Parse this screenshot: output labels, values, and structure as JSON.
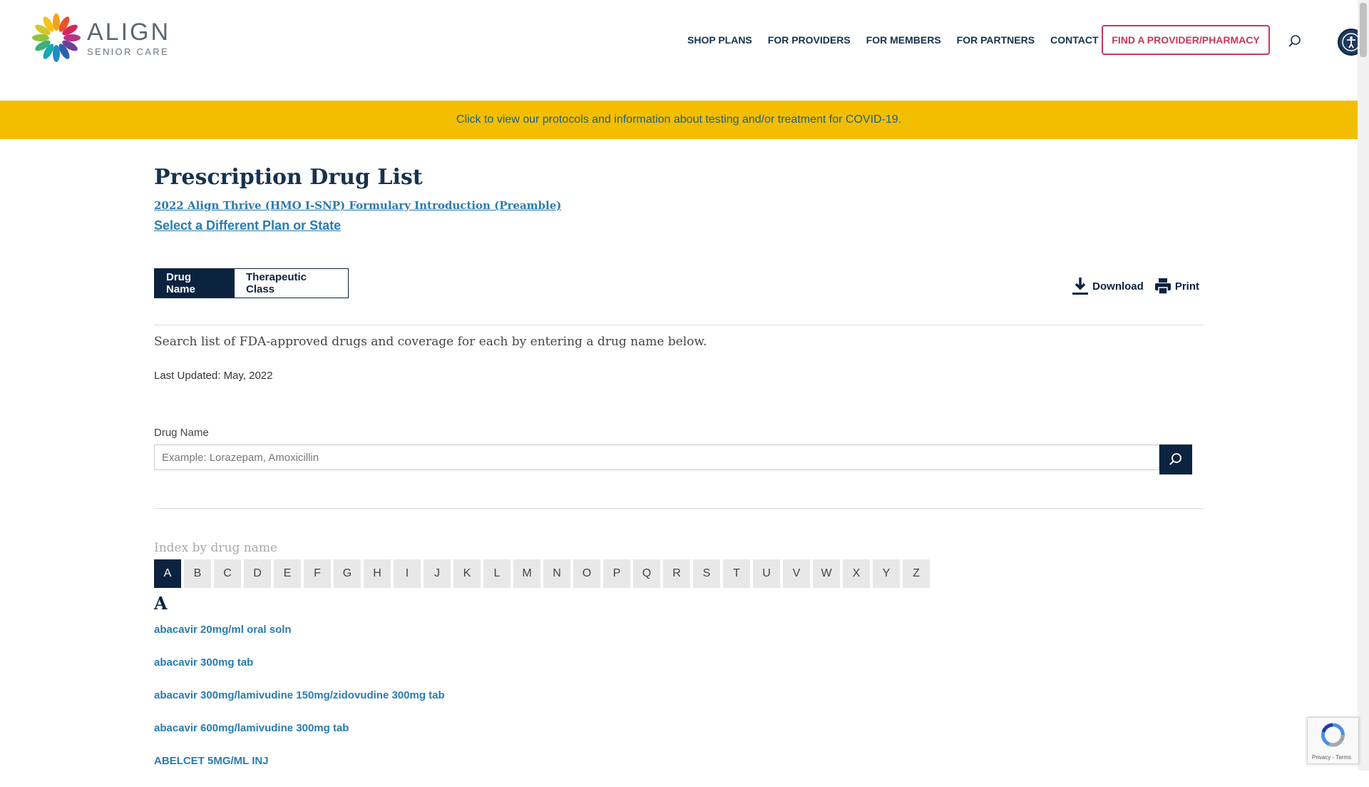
{
  "header": {
    "logo_main": "ALIGN",
    "logo_sub": "SENIOR CARE",
    "nav": [
      "SHOP PLANS",
      "FOR PROVIDERS",
      "FOR MEMBERS",
      "FOR PARTNERS",
      "CONTACT US"
    ],
    "find_button": "FIND A PROVIDER/PHARMACY"
  },
  "banner": {
    "text": "Click to view our protocols and information about testing and/or treatment for COVID-19."
  },
  "main": {
    "title": "Prescription Drug List",
    "preamble_link": "2022 Align Thrive (HMO I-SNP) Formulary Introduction (Preamble)",
    "plan_link": "Select a Different Plan or State",
    "tabs": [
      {
        "label": "Drug Name",
        "active": true
      },
      {
        "label": "Therapeutic Class",
        "active": false
      }
    ],
    "download_label": "Download",
    "print_label": "Print",
    "description": "Search list of FDA-approved drugs and coverage for each by entering a drug name below.",
    "last_updated": "Last Updated: May, 2022",
    "search": {
      "label": "Drug Name",
      "placeholder": "Example: Lorazepam, Amoxicillin",
      "value": ""
    },
    "index_label": "Index by drug name",
    "letters": [
      "A",
      "B",
      "C",
      "D",
      "E",
      "F",
      "G",
      "H",
      "I",
      "J",
      "K",
      "L",
      "M",
      "N",
      "O",
      "P",
      "Q",
      "R",
      "S",
      "T",
      "U",
      "V",
      "W",
      "X",
      "Y",
      "Z"
    ],
    "selected_letter": "A",
    "section_heading": "A",
    "drugs": [
      "abacavir 20mg/ml oral soln",
      "abacavir 300mg tab",
      "abacavir 300mg/lamivudine 150mg/zidovudine 300mg tab",
      "abacavir 600mg/lamivudine 300mg tab",
      "ABELCET 5MG/ML INJ"
    ]
  },
  "recaptcha": {
    "terms": "Privacy - Terms"
  },
  "colors": {
    "navy": "#0c2340",
    "link_blue": "#2a7bb0",
    "banner_yellow": "#f3be00",
    "accent_pink": "#c8385b"
  }
}
